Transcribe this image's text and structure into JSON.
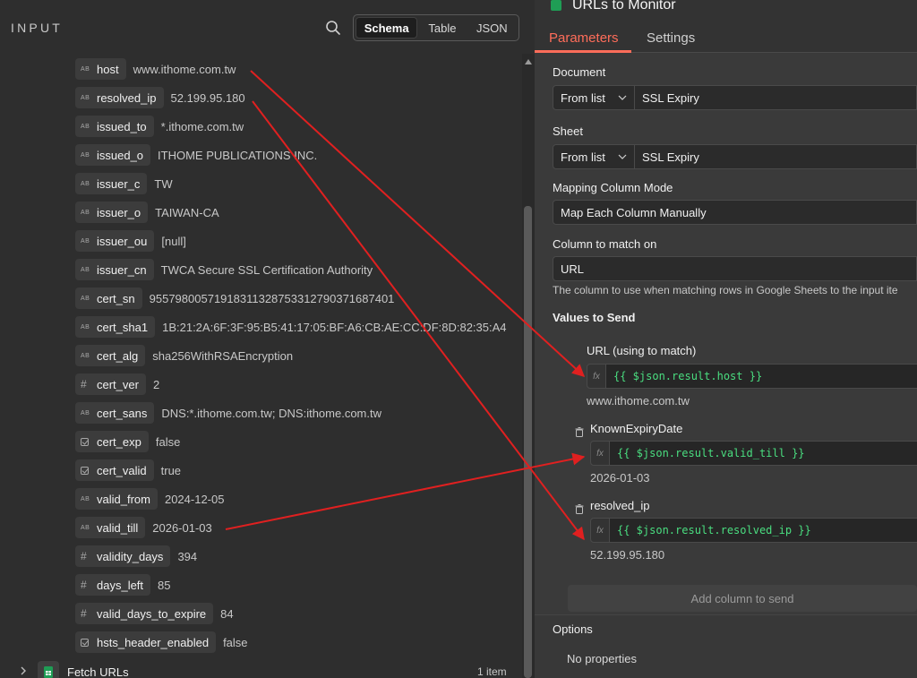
{
  "input_panel": {
    "title": "INPUT",
    "view_options": [
      "Schema",
      "Table",
      "JSON"
    ],
    "active_view": "Schema",
    "fields": [
      {
        "type": "string",
        "key": "host",
        "value": "www.ithome.com.tw"
      },
      {
        "type": "string",
        "key": "resolved_ip",
        "value": "52.199.95.180"
      },
      {
        "type": "string",
        "key": "issued_to",
        "value": "*.ithome.com.tw"
      },
      {
        "type": "string",
        "key": "issued_o",
        "value": "ITHOME PUBLICATIONS INC."
      },
      {
        "type": "string",
        "key": "issuer_c",
        "value": "TW"
      },
      {
        "type": "string",
        "key": "issuer_o",
        "value": "TAIWAN-CA"
      },
      {
        "type": "string",
        "key": "issuer_ou",
        "value": "[null]"
      },
      {
        "type": "string",
        "key": "issuer_cn",
        "value": "TWCA Secure SSL Certification Authority"
      },
      {
        "type": "string",
        "key": "cert_sn",
        "value": "95579800571918311328753312790371687401"
      },
      {
        "type": "string",
        "key": "cert_sha1",
        "value": "1B:21:2A:6F:3F:95:B5:41:17:05:BF:A6:CB:AE:CC:DF:8D:82:35:A4"
      },
      {
        "type": "string",
        "key": "cert_alg",
        "value": "sha256WithRSAEncryption"
      },
      {
        "type": "number",
        "key": "cert_ver",
        "value": "2"
      },
      {
        "type": "string",
        "key": "cert_sans",
        "value": "DNS:*.ithome.com.tw; DNS:ithome.com.tw"
      },
      {
        "type": "boolean",
        "key": "cert_exp",
        "value": "false"
      },
      {
        "type": "boolean",
        "key": "cert_valid",
        "value": "true"
      },
      {
        "type": "string",
        "key": "valid_from",
        "value": "2024-12-05"
      },
      {
        "type": "string",
        "key": "valid_till",
        "value": "2026-01-03"
      },
      {
        "type": "number",
        "key": "validity_days",
        "value": "394"
      },
      {
        "type": "number",
        "key": "days_left",
        "value": "85"
      },
      {
        "type": "number",
        "key": "valid_days_to_expire",
        "value": "84"
      },
      {
        "type": "boolean",
        "key": "hsts_header_enabled",
        "value": "false"
      }
    ],
    "source_node": {
      "label": "Fetch URLs",
      "count": "1 item"
    }
  },
  "node": {
    "title": "URLs to Monitor",
    "tabs": [
      "Parameters",
      "Settings"
    ],
    "active_tab": "Parameters",
    "document": {
      "label": "Document",
      "mode": "From list",
      "value": "SSL Expiry"
    },
    "sheet": {
      "label": "Sheet",
      "mode": "From list",
      "value": "SSL Expiry"
    },
    "mapping_mode": {
      "label": "Mapping Column Mode",
      "value": "Map Each Column Manually"
    },
    "match_column": {
      "label": "Column to match on",
      "value": "URL",
      "hint": "The column to use when matching rows in Google Sheets to the input ite"
    },
    "values_to_send": {
      "label": "Values to Send",
      "items": [
        {
          "name": "URL (using to match)",
          "expression": "{{ $json.result.host }}",
          "result": "www.ithome.com.tw"
        },
        {
          "name": "KnownExpiryDate",
          "expression": "{{ $json.result.valid_till }}",
          "result": "2026-01-03"
        },
        {
          "name": "resolved_ip",
          "expression": "{{ $json.result.resolved_ip }}",
          "result": "52.199.95.180"
        }
      ]
    },
    "add_column_label": "Add column to send",
    "options": {
      "label": "Options",
      "empty": "No properties"
    }
  },
  "colors": {
    "accent": "#ff6d5a",
    "expression": "#4ade80",
    "arrow": "#e02020",
    "sheets": "#1f9d55"
  }
}
